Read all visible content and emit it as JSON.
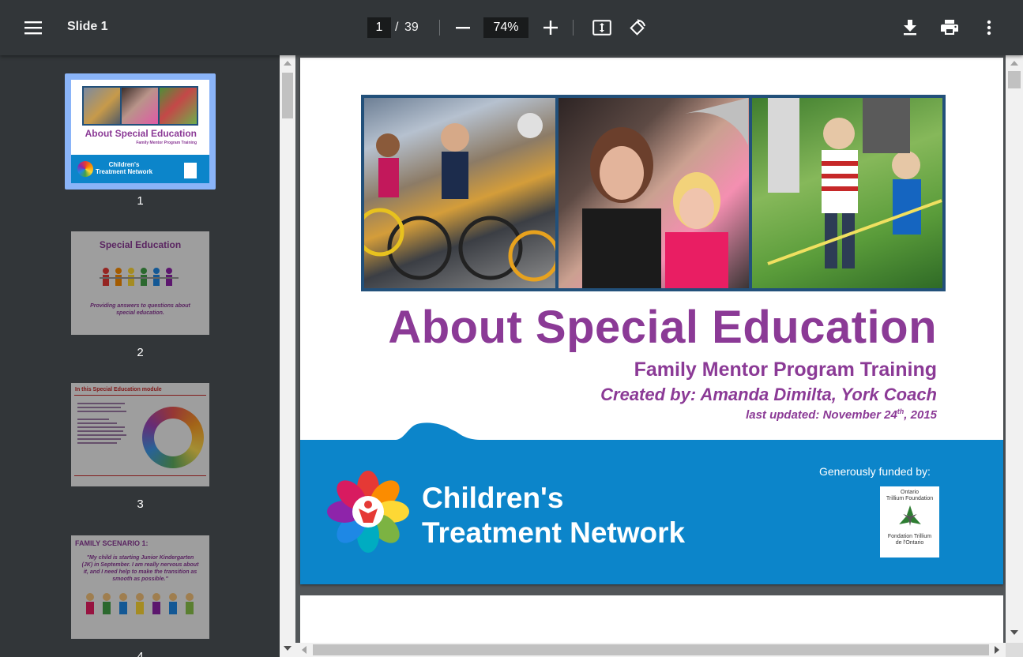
{
  "toolbar": {
    "title": "Slide 1",
    "current_page": "1",
    "page_separator": "/",
    "total_pages": "39",
    "zoom": "74%"
  },
  "thumbnails": [
    {
      "num": "1",
      "title": "About Special Education",
      "sub": "Family Mentor Program Training",
      "selected": true
    },
    {
      "num": "2",
      "title": "Special Education",
      "caption": "Providing answers to questions about special education.",
      "selected": false
    },
    {
      "num": "3",
      "title": "In this Special Education module",
      "selected": false
    },
    {
      "num": "4",
      "title": "FAMILY SCENARIO 1:",
      "quote": "\"My child is starting Junior Kindergarten (JK) in September. I am really nervous about it, and I need help to make the transition as smooth as possible.\"",
      "selected": false
    }
  ],
  "slide": {
    "title": "About Special Education",
    "subtitle": "Family Mentor Program Training",
    "author": "Created by: Amanda Dimilta, York Coach",
    "updated_prefix": "last updated: November 24",
    "updated_sup": "th",
    "updated_suffix": ", 2015",
    "funded_by": "Generously funded by:",
    "org_line1": "Children's",
    "org_line2": "Treatment Network",
    "otf_line1": "Ontario",
    "otf_line2": "Trillium Foundation",
    "otf_line3": "Fondation Trillium",
    "otf_line4": "de l'Ontario"
  },
  "colors": {
    "accent_purple": "#8b3a96",
    "band_blue": "#0c85ca",
    "toolbar": "#323639",
    "viewer_bg": "#525659",
    "selection": "#8ab4f8"
  }
}
